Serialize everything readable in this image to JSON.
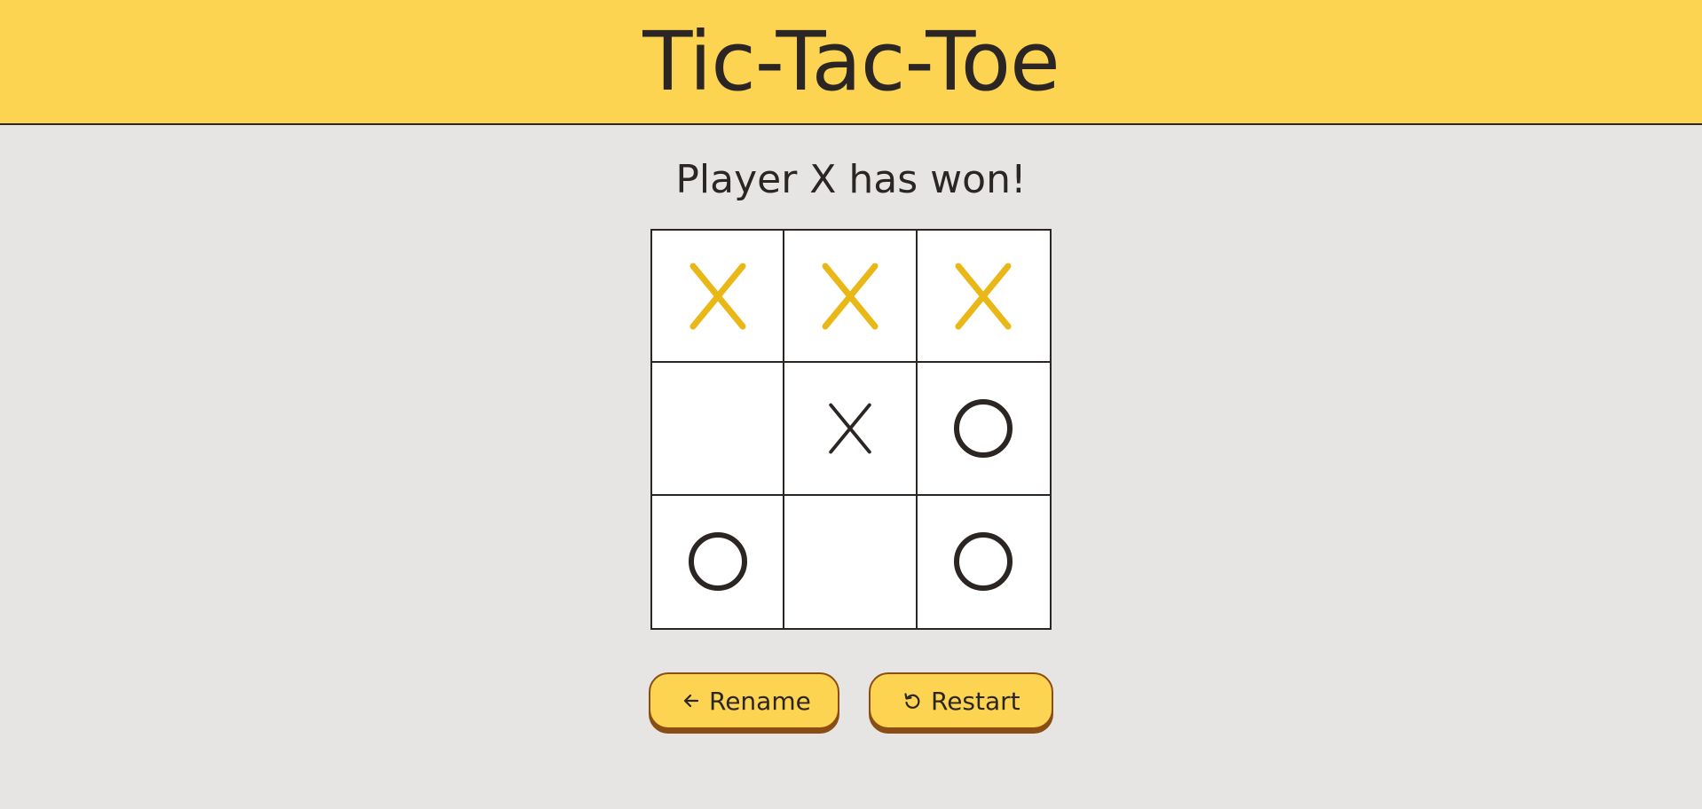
{
  "header": {
    "title": "Tic-Tac-Toe"
  },
  "status": {
    "message": "Player X has won!"
  },
  "board": {
    "cells": [
      "X",
      "X",
      "X",
      "",
      "X",
      "O",
      "O",
      "",
      "O"
    ],
    "winning_cells": [
      0,
      1,
      2
    ]
  },
  "colors": {
    "accent": "#fcd452",
    "win_mark": "#e9b817",
    "mark": "#2b2623",
    "button_shadow": "#8a4e14",
    "background": "#e6e5e4"
  },
  "actions": {
    "rename_label": "Rename",
    "rename_icon": "arrow-left-icon",
    "restart_label": "Restart",
    "restart_icon": "restart-icon"
  }
}
